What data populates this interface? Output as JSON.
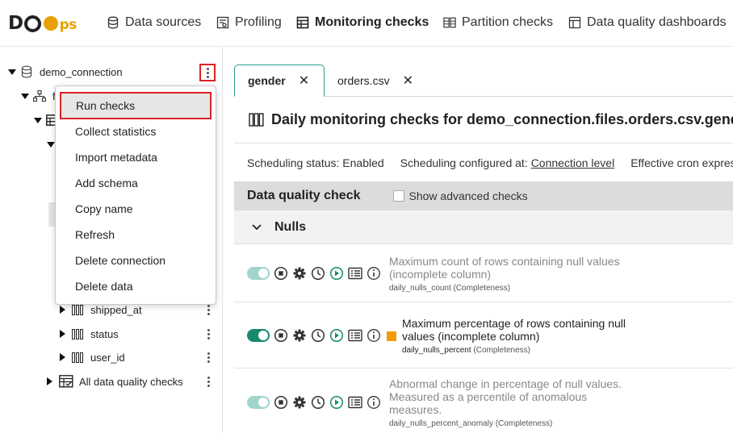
{
  "logo": {
    "text_a": "D",
    "text_b": "O",
    "text_ps": "ps"
  },
  "nav": [
    {
      "label": "Data sources",
      "icon": "database-icon"
    },
    {
      "label": "Profiling",
      "icon": "profiling-icon"
    },
    {
      "label": "Monitoring checks",
      "icon": "table-icon",
      "active": true
    },
    {
      "label": "Partition checks",
      "icon": "partition-icon"
    },
    {
      "label": "Data quality dashboards",
      "icon": "dashboard-icon"
    }
  ],
  "tree": {
    "connection": "demo_connection",
    "schema_initial": "f",
    "columns": [
      "shipped_at",
      "status",
      "user_id"
    ],
    "all_checks": "All data quality checks"
  },
  "context_menu": {
    "items": [
      "Run checks",
      "Collect statistics",
      "Import metadata",
      "Add schema",
      "Copy name",
      "Refresh",
      "Delete connection",
      "Delete data"
    ]
  },
  "tabs": [
    {
      "label": "gender",
      "active": true
    },
    {
      "label": "orders.csv",
      "active": false
    }
  ],
  "title": "Daily monitoring checks for demo_connection.files.orders.csv.gend",
  "scheduling": {
    "status": "Scheduling status: Enabled",
    "configured_label": "Scheduling configured at:",
    "configured_value": "Connection level",
    "cron": "Effective cron expres"
  },
  "table_header": {
    "label": "Data quality check",
    "advanced": "Show advanced checks"
  },
  "group": {
    "name": "Nulls"
  },
  "checks": [
    {
      "line1": "Maximum count of rows containing null values",
      "line2": "(incomplete column)",
      "line3": "",
      "name": "daily_nulls_count",
      "category": "(Completeness)",
      "enabled": false
    },
    {
      "line1": "Maximum percentage of rows containing null",
      "line2": "values (incomplete column)",
      "line3": "",
      "name": "daily_nulls_percent",
      "category": "(Completeness)",
      "enabled": true
    },
    {
      "line1": "Abnormal change in percentage of null values.",
      "line2": "Measured as a percentile of anomalous",
      "line3": "measures.",
      "name": "daily_nulls_percent_anomaly",
      "category": "(Completeness)",
      "enabled": false
    }
  ],
  "colors": {
    "accent": "#178a6c",
    "toggle_off": "#9fd5cc",
    "severity": "#f29b00",
    "highlight": "#dd2222",
    "logo_accent": "#e6a100"
  }
}
